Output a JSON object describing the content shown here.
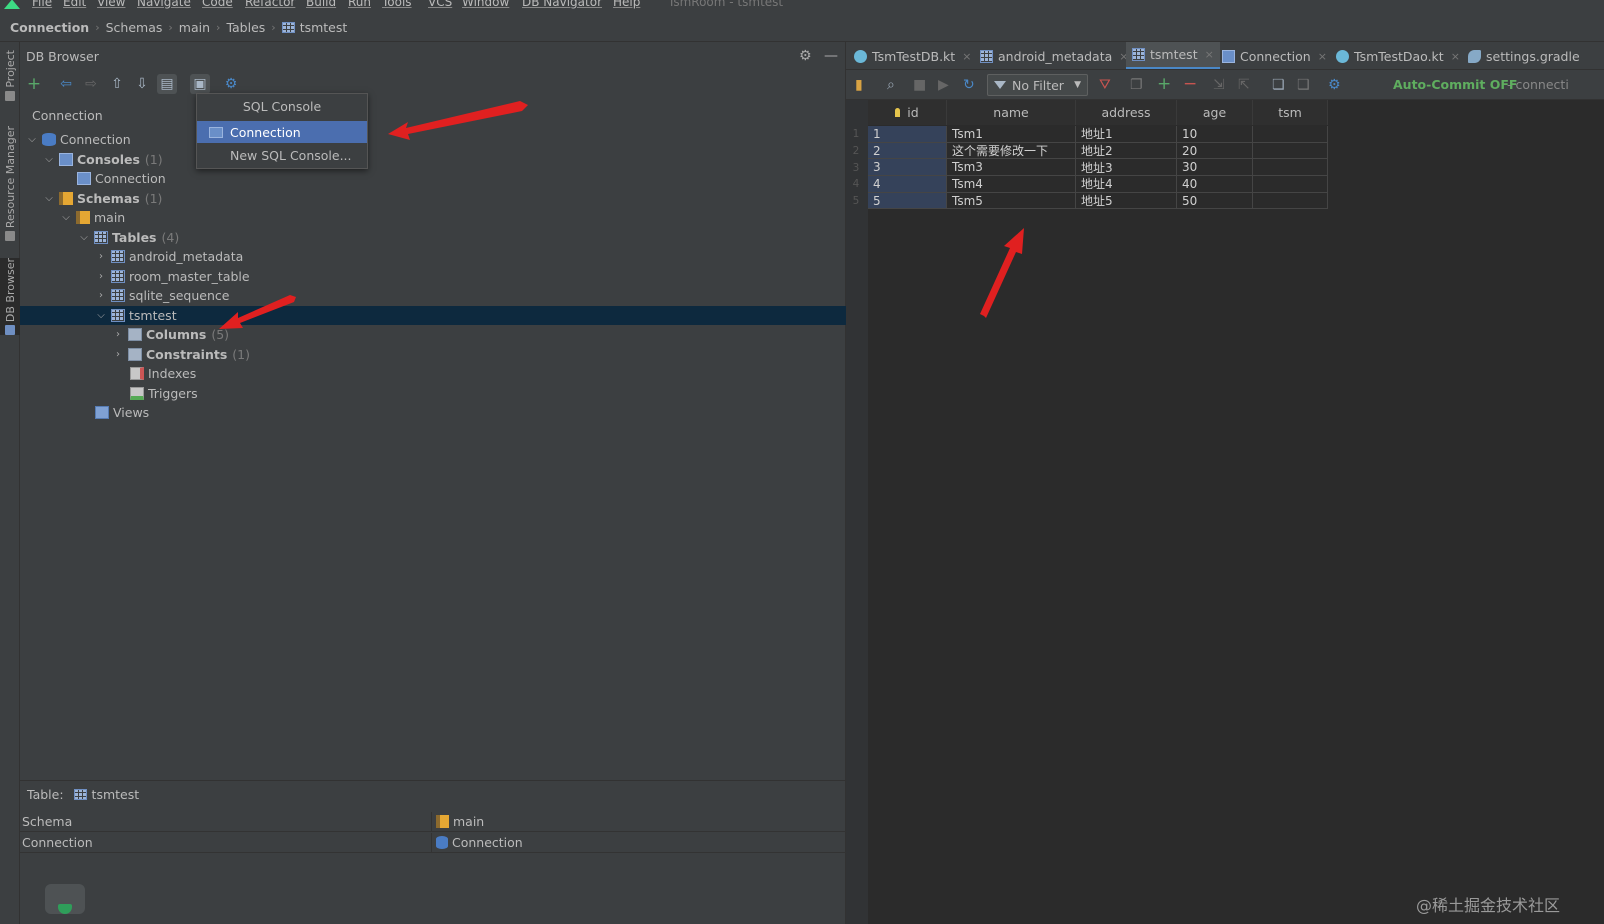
{
  "menubar": {
    "items": [
      "File",
      "Edit",
      "View",
      "Navigate",
      "Code",
      "Refactor",
      "Build",
      "Run",
      "Tools",
      "VCS",
      "Window",
      "DB Navigator",
      "Help"
    ],
    "window_title": "TsmRoom - tsmtest"
  },
  "breadcrumb": [
    "Connection",
    "Schemas",
    "main",
    "Tables",
    "tsmtest"
  ],
  "side_tabs": [
    "Project",
    "Resource Manager",
    "DB Browser"
  ],
  "db_browser": {
    "title": "DB Browser",
    "tree_title": "Connection",
    "tree": [
      {
        "label": "Connection",
        "count": "",
        "level": 0,
        "expanded": true,
        "icon": "db-icon",
        "bold": false
      },
      {
        "label": "Consoles",
        "count": "(1)",
        "level": 1,
        "expanded": true,
        "icon": "console-icon",
        "bold": true
      },
      {
        "label": "Connection",
        "count": "",
        "level": 2,
        "expanded": null,
        "icon": "console-icon",
        "bold": false
      },
      {
        "label": "Schemas",
        "count": "(1)",
        "level": 1,
        "expanded": true,
        "icon": "schema-icon",
        "bold": true
      },
      {
        "label": "main",
        "count": "",
        "level": 2,
        "expanded": true,
        "icon": "schema-icon",
        "bold": false
      },
      {
        "label": "Tables",
        "count": "(4)",
        "level": 3,
        "expanded": true,
        "icon": "table-icon",
        "bold": true
      },
      {
        "label": "android_metadata",
        "count": "",
        "level": 4,
        "expanded": false,
        "icon": "table-icon",
        "bold": false
      },
      {
        "label": "room_master_table",
        "count": "",
        "level": 4,
        "expanded": false,
        "icon": "table-icon",
        "bold": false
      },
      {
        "label": "sqlite_sequence",
        "count": "",
        "level": 4,
        "expanded": false,
        "icon": "table-icon",
        "bold": false
      },
      {
        "label": "tsmtest",
        "count": "",
        "level": 4,
        "expanded": true,
        "icon": "table-icon",
        "bold": false,
        "selected": true
      },
      {
        "label": "Columns",
        "count": "(5)",
        "level": 5,
        "expanded": false,
        "icon": "columns-icon",
        "bold": true
      },
      {
        "label": "Constraints",
        "count": "(1)",
        "level": 5,
        "expanded": false,
        "icon": "constraints-icon",
        "bold": true
      },
      {
        "label": "Indexes",
        "count": "",
        "level": 5,
        "expanded": null,
        "icon": "indexes-icon",
        "bold": false
      },
      {
        "label": "Triggers",
        "count": "",
        "level": 5,
        "expanded": null,
        "icon": "triggers-icon",
        "bold": false
      },
      {
        "label": "Views",
        "count": "",
        "level": 3,
        "expanded": null,
        "icon": "views-icon",
        "bold": false
      }
    ],
    "popup": [
      "SQL Console",
      "Connection",
      "New SQL Console..."
    ],
    "popup_selected": 1,
    "details": {
      "title_label": "Table:",
      "title_value": "tsmtest",
      "rows": [
        {
          "key": "Schema",
          "value": "main"
        },
        {
          "key": "Connection",
          "value": "Connection"
        }
      ]
    }
  },
  "editor_tabs": [
    {
      "label": "TsmTestDB.kt",
      "icon": "kotlin-icon",
      "active": false,
      "closable": true
    },
    {
      "label": "android_metadata",
      "icon": "table-icon",
      "active": false,
      "closable": true
    },
    {
      "label": "tsmtest",
      "icon": "table-icon",
      "active": true,
      "closable": true
    },
    {
      "label": "Connection",
      "icon": "console-icon",
      "active": false,
      "closable": true
    },
    {
      "label": "TsmTestDao.kt",
      "icon": "kotlin-icon",
      "active": false,
      "closable": true
    },
    {
      "label": "settings.gradle",
      "icon": "gradle-icon",
      "active": false,
      "closable": false
    }
  ],
  "grid_toolbar": {
    "filter": "No Filter",
    "autocommit": "Auto-Commit OFF",
    "connection_suffix": "- connecti"
  },
  "table": {
    "columns": [
      "id",
      "name",
      "address",
      "age",
      "tsm"
    ],
    "rows": [
      [
        "1",
        "Tsm1",
        "地址1",
        "10",
        ""
      ],
      [
        "2",
        "这个需要修改一下",
        "地址2",
        "20",
        ""
      ],
      [
        "3",
        "Tsm3",
        "地址3",
        "30",
        ""
      ],
      [
        "4",
        "Tsm4",
        "地址4",
        "40",
        ""
      ],
      [
        "5",
        "Tsm5",
        "地址5",
        "50",
        ""
      ]
    ],
    "row_numbers": [
      "1",
      "2",
      "3",
      "4",
      "5"
    ]
  },
  "watermark": "@稀土掘金技术社区",
  "colors": {
    "accent": "#4b6eaf",
    "selection": "#0d293e",
    "autocommit": "#5fae5f",
    "annotation_arrow": "#e02020"
  }
}
